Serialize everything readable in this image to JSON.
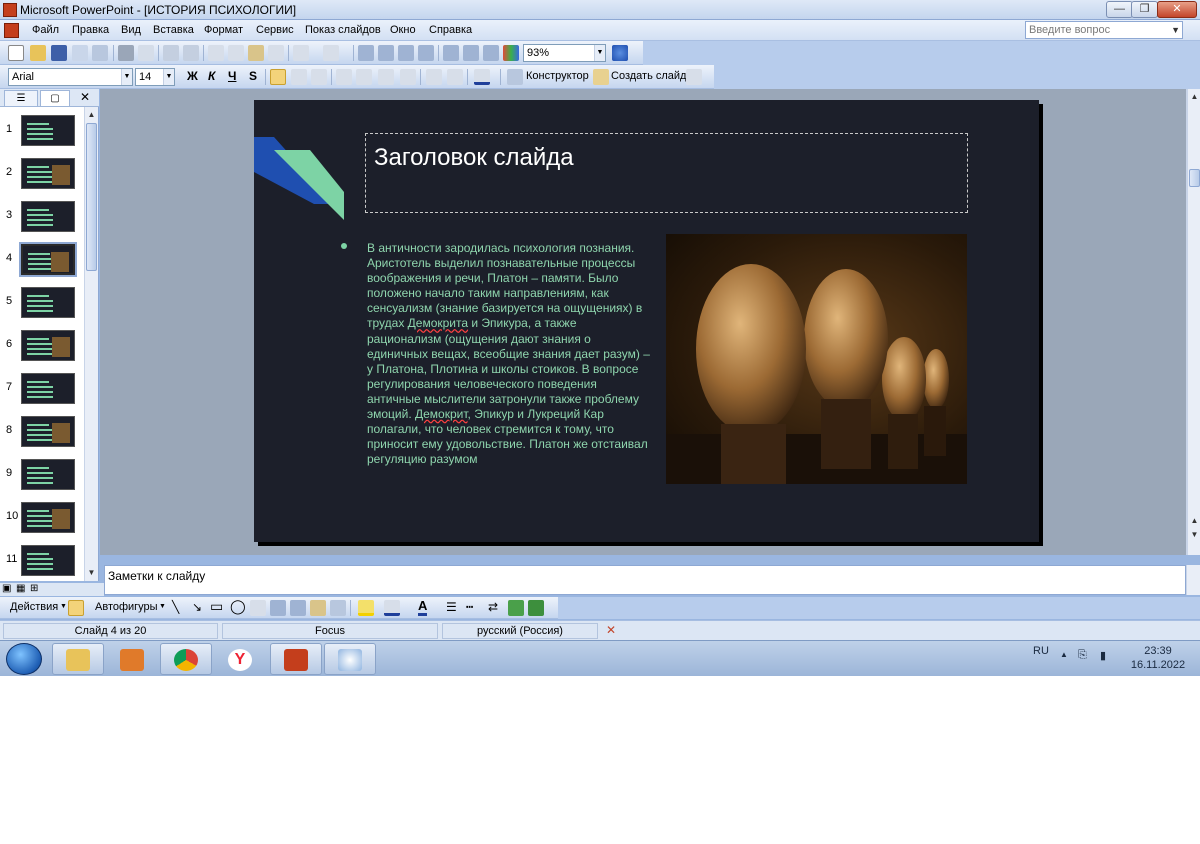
{
  "window": {
    "title": "Microsoft PowerPoint - [ИСТОРИЯ ПСИХОЛОГИИ]",
    "min_label": "—",
    "restore_label": "❐",
    "close_label": "✕"
  },
  "menubar": {
    "items": [
      "Файл",
      "Правка",
      "Вид",
      "Вставка",
      "Формат",
      "Сервис",
      "Показ слайдов",
      "Окно",
      "Справка"
    ],
    "help_placeholder": "Введите вопрос"
  },
  "toolbar": {
    "zoom": "93%",
    "font_name": "Arial",
    "font_size": "14",
    "bold_label": "Ж",
    "italic_label": "К",
    "underline_label": "Ч",
    "shadow_label": "S",
    "designer_label": "Конструктор",
    "new_slide_label": "Создать слайд"
  },
  "slide_pane": {
    "thumbnail_count": 11,
    "selected": 4,
    "numbers": [
      "1",
      "2",
      "3",
      "4",
      "5",
      "6",
      "7",
      "8",
      "9",
      "10",
      "11"
    ]
  },
  "slide": {
    "title": "Заголовок слайда",
    "body_before_1": "В античности зародилась психология познания. Аристотель выделил познавательные процессы воображения и речи, Платон – памяти.  Было положено начало таким направлениям, как сенсуализм (знание базируется на ощущениях) в трудах ",
    "spell_1": "Демокрита",
    "body_mid": " и Эпикура, а также рационализм (ощущения дают знания о единичных вещах, всеобщие знания дает разум) – у Платона, Плотина и школы стоиков.  В вопросе регулирования человеческого поведения античные мыслители затронули также проблему эмоций. ",
    "spell_2": "Демокрит",
    "body_after": ", Эпикур и Лукреций Кар полагали, что человек стремится к тому, что приносит ему удовольствие. Платон же отстаивал регуляцию разумом"
  },
  "notes": {
    "placeholder": "Заметки к слайду"
  },
  "drawing_toolbar": {
    "actions_label": "Действия",
    "autoshapes_label": "Автофигуры"
  },
  "statusbar": {
    "slide_info": "Слайд 4 из 20",
    "design": "Focus",
    "language": "русский (Россия)"
  },
  "taskbar": {
    "lang": "RU",
    "time": "23:39",
    "date": "16.11.2022"
  },
  "colors": {
    "slide_bg": "#1c1f2a",
    "accent_green": "#7dd3a5",
    "accent_blue": "#1f4fb0",
    "body_text": "#8fd6ae"
  }
}
